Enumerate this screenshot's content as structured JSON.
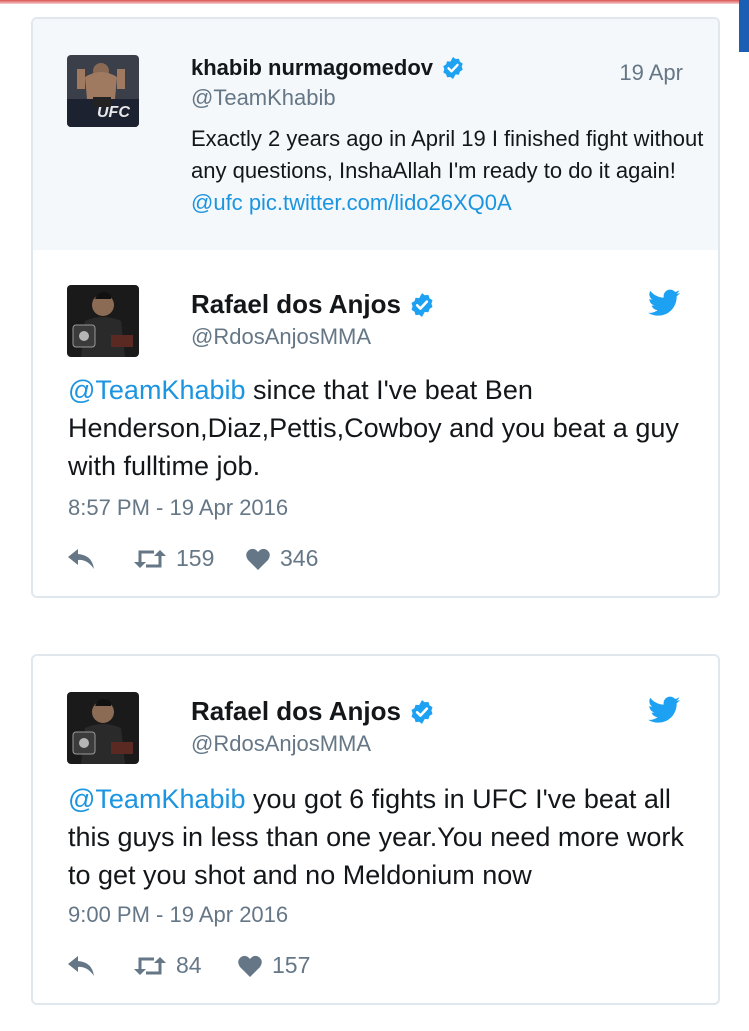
{
  "quoted_tweet": {
    "name": "khabib nurmagomedov",
    "handle": "@TeamKhabib",
    "date": "19 Apr",
    "text_plain": "Exactly 2 years ago in April 19 I finished fight without any questions, InshaAllah I'm ready to do it again! ",
    "mention": "@ufc",
    "pic_link": "pic.twitter.com/lido26XQ0A"
  },
  "tweets": [
    {
      "name": "Rafael dos Anjos",
      "handle": "@RdosAnjosMMA",
      "mention": "@TeamKhabib",
      "text": " since that I've beat Ben Henderson,Diaz,Pettis,Cowboy and you beat a guy with fulltime job.",
      "time": "8:57 PM - 19 Apr 2016",
      "retweets": "159",
      "likes": "346"
    },
    {
      "name": "Rafael dos Anjos",
      "handle": "@RdosAnjosMMA",
      "mention": "@TeamKhabib",
      "text": " you got 6 fights in UFC I've beat all this guys in less than one year.You need more work to get you shot and no Meldonium now",
      "time": "9:00 PM - 19 Apr 2016",
      "retweets": "84",
      "likes": "157"
    }
  ],
  "colors": {
    "link": "#1b95e0",
    "verified": "#1da1f2",
    "muted": "#657786",
    "quoted_bg": "#f5f8fa"
  },
  "icons": [
    "verified-badge-icon",
    "twitter-bird-icon",
    "reply-icon",
    "retweet-icon",
    "heart-icon"
  ]
}
